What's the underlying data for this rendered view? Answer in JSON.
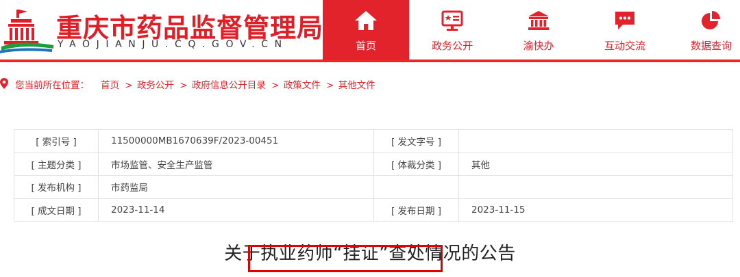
{
  "site": {
    "title": "重庆市药品监督管理局",
    "domain": "YAOJIANJU.CQ.GOV.CN"
  },
  "nav": [
    {
      "label": "首页",
      "icon": "home-icon",
      "active": true
    },
    {
      "label": "政务公开",
      "icon": "government-affairs-icon",
      "active": false
    },
    {
      "label": "渝快办",
      "icon": "government-building-icon",
      "active": false
    },
    {
      "label": "互动交流",
      "icon": "chat-bubble-icon",
      "active": false
    },
    {
      "label": "数据查询",
      "icon": "pie-chart-icon",
      "active": false
    }
  ],
  "breadcrumb": {
    "prefix": "您当前所在位置：",
    "items": [
      "首页",
      "政务公开",
      "政府信息公开目录",
      "政策文件",
      "其他文件"
    ],
    "separator": ">"
  },
  "info": {
    "index_label": "[ 索引号 ]",
    "index_value": "11500000MB1670639F/2023-00451",
    "doc_no_label": "[ 发文字号 ]",
    "doc_no_value": "",
    "topic_label": "[ 主题分类 ]",
    "topic_value": "市场监管、安全生产监管",
    "genre_label": "[ 体裁分类 ]",
    "genre_value": "其他",
    "publisher_label": "[ 发布机构 ]",
    "publisher_value": "市药监局",
    "created_label": "[ 成文日期 ]",
    "created_value": "2023-11-14",
    "published_label": "[ 发布日期 ]",
    "published_value": "2023-11-15"
  },
  "article": {
    "title": "关于执业药师“挂证”查处情况的公告"
  },
  "colors": {
    "brand_red": "#e3232b",
    "title_red": "#e11d25",
    "highlight_red": "#e00000"
  }
}
